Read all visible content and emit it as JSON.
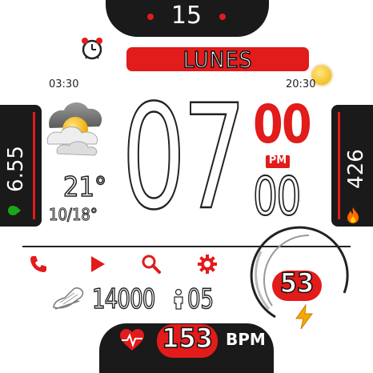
{
  "date": {
    "day": "15",
    "weekday": "LUNES"
  },
  "sun": {
    "sunrise": "03:30",
    "sunset": "20:30"
  },
  "weather": {
    "temp": "21°",
    "range": "10/18°",
    "icon": "partly-cloudy-icon"
  },
  "time": {
    "hour": "07",
    "minute_top": "00",
    "ampm": "PM",
    "minute_bottom": "00"
  },
  "distance": {
    "value": "6.55",
    "icon": "location-pins-icon"
  },
  "calories": {
    "value": "426",
    "icon": "flame-icon"
  },
  "shortcuts": [
    "phone-icon",
    "play-icon",
    "search-icon",
    "settings-gear-icon"
  ],
  "steps": {
    "value": "14000",
    "icon": "shoe-icon"
  },
  "floors": {
    "value": "05",
    "icon": "person-icon"
  },
  "battery": {
    "value": "53",
    "percent": 53,
    "icon": "lightning-icon"
  },
  "heart": {
    "value": "153",
    "unit": "BPM",
    "icon": "heart-pulse-icon"
  },
  "colors": {
    "accent": "#e21b1b",
    "dark": "#1a1a1a",
    "pin": "#1aa51a",
    "flame": "#ff6a00"
  }
}
